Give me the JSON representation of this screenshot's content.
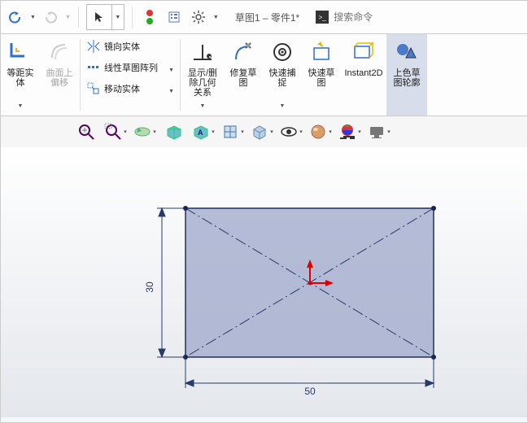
{
  "topbar": {
    "title": "草图1 – 零件1*",
    "search_placeholder": "搜索命令"
  },
  "ribbon": {
    "equidist": "等距实\n体",
    "offset": "曲面上\n偏移",
    "mirror": "镜向实体",
    "linear": "线性草图阵列",
    "move": "移动实体",
    "display": "显示/删\n除几何\n关系",
    "repair": "修复草\n图",
    "quicksnap": "快速捕\n捉",
    "rapidsketch": "快速草\n图",
    "instant2d": "Instant2D",
    "shade": "上色草\n图轮廓"
  },
  "dims": {
    "w": "50",
    "h": "30"
  }
}
